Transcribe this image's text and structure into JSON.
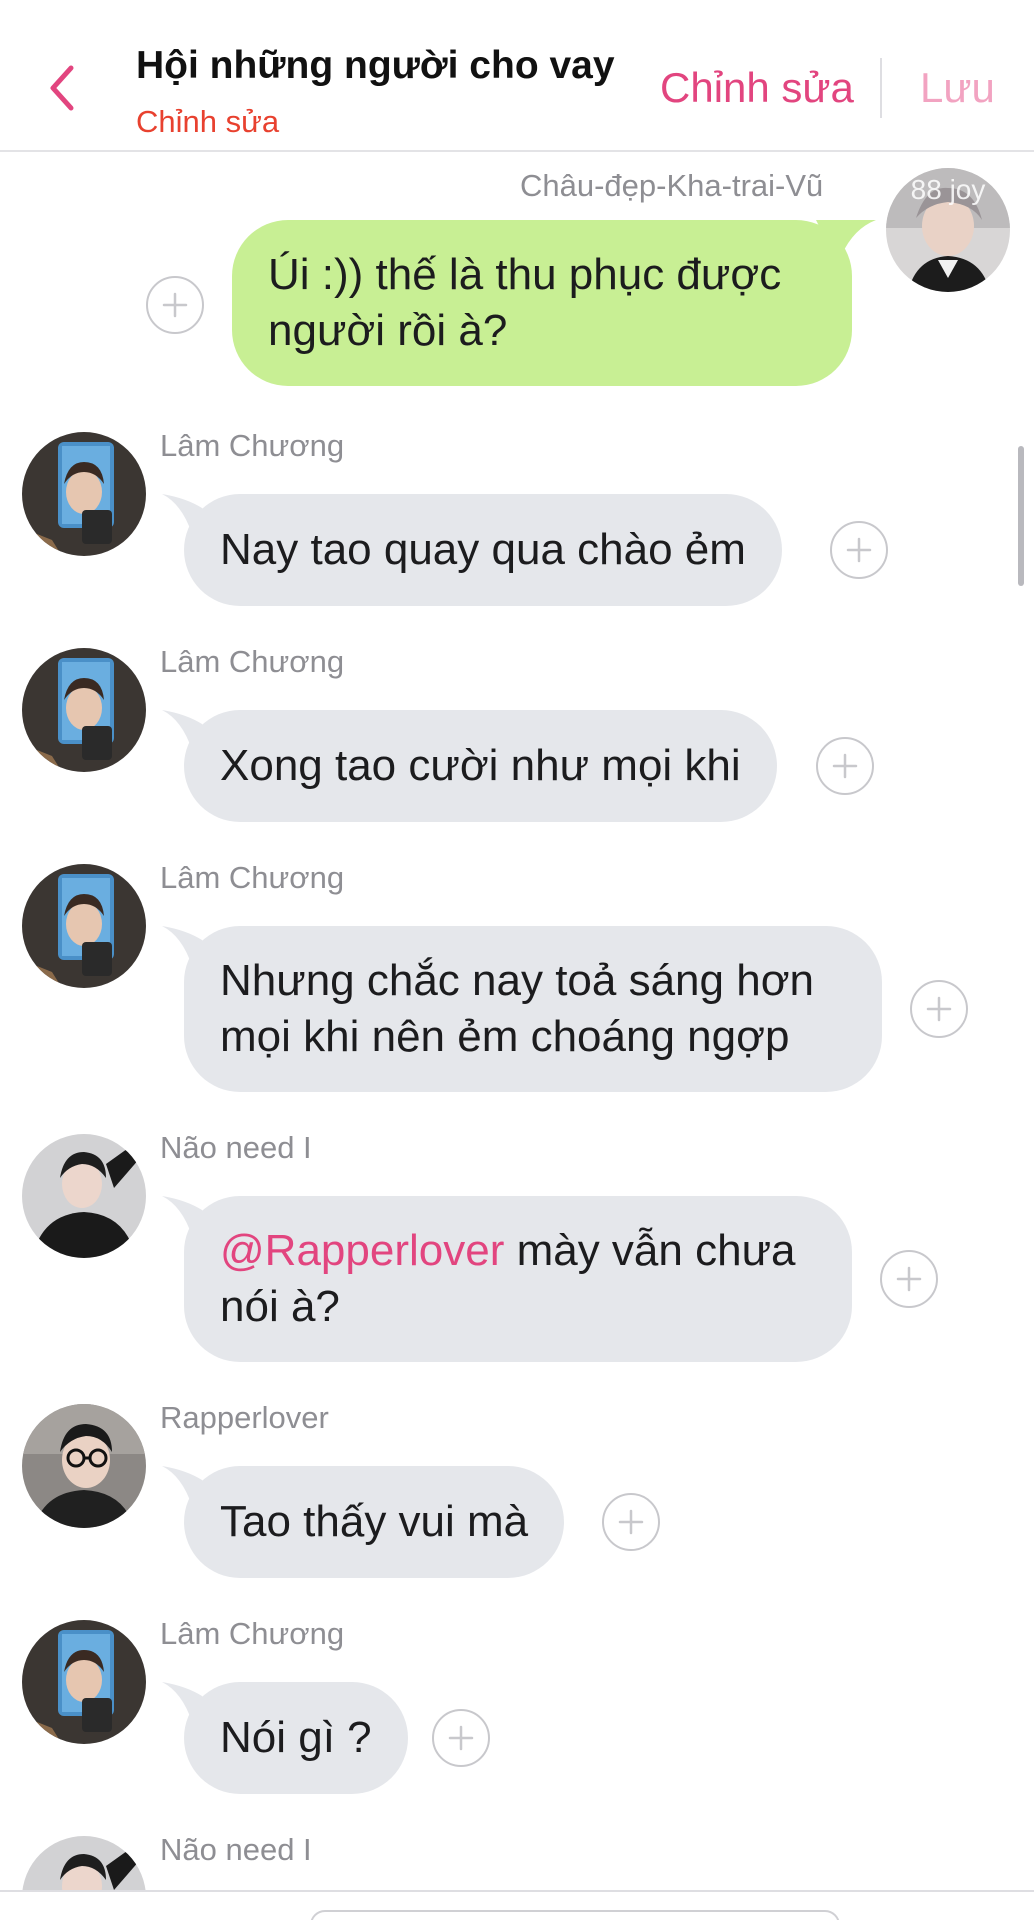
{
  "header": {
    "title": "Hội những người cho vay",
    "subtitle": "Chỉnh sửa",
    "edit_label": "Chỉnh sửa",
    "save_label": "Lưu",
    "accent": "#e2457f"
  },
  "messages": [
    {
      "direction": "out",
      "sender": "Châu-đẹp-Kha-trai-Vũ",
      "text": "Úi :)) thế là thu phục được người rồi à?",
      "avatar_overlay": "88 joy"
    },
    {
      "direction": "in",
      "sender": "Lâm Chương",
      "text": "Nay tao quay qua chào ẻm"
    },
    {
      "direction": "in",
      "sender": "Lâm Chương",
      "text": "Xong tao cười như mọi khi"
    },
    {
      "direction": "in",
      "sender": "Lâm Chương",
      "text": "Nhưng chắc nay toả sáng hơn mọi khi nên ẻm choáng ngợp"
    },
    {
      "direction": "in",
      "sender": "Não need I",
      "mention": "@Rapperlover",
      "text": " mày vẫn chưa nói à?"
    },
    {
      "direction": "in",
      "sender": "Rapperlover",
      "text": "Tao thấy vui mà"
    },
    {
      "direction": "in",
      "sender": "Lâm Chương",
      "text": "Nói gì ?"
    },
    {
      "direction": "in",
      "sender": "Não need I",
      "text": ""
    }
  ],
  "icons": {
    "back": "chevron-left-icon",
    "react": "plus-circle-icon"
  },
  "colors": {
    "outgoing_bubble": "#c8ef94",
    "incoming_bubble": "#e5e7eb",
    "mention": "#e2457f",
    "subtitle": "#e8412f"
  }
}
